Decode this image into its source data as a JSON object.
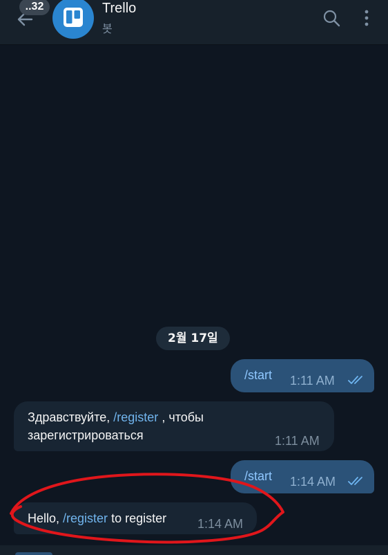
{
  "header": {
    "unread_count": "..32",
    "title": "Trello",
    "subtitle": "봇",
    "avatar_icon": "trello-logo-icon",
    "colors": {
      "header_bg": "#17212b",
      "avatar_bg": "#2a85d0",
      "subtitle": "#7f91a4"
    }
  },
  "date_separator": "2월 17일",
  "messages": [
    {
      "direction": "outgoing",
      "parts": [
        {
          "type": "command",
          "text": "/start"
        }
      ],
      "time": "1:11 AM",
      "status": "read-double-check"
    },
    {
      "direction": "incoming",
      "parts": [
        {
          "type": "text",
          "text": "Здравствуйте, "
        },
        {
          "type": "command",
          "text": "/register"
        },
        {
          "type": "text",
          "text": " , чтобы зарегистрироваться"
        }
      ],
      "time": "1:11 AM"
    },
    {
      "direction": "outgoing",
      "parts": [
        {
          "type": "command",
          "text": "/start"
        }
      ],
      "time": "1:14 AM",
      "status": "read-double-check"
    },
    {
      "direction": "incoming",
      "parts": [
        {
          "type": "text",
          "text": "Hello, "
        },
        {
          "type": "command",
          "text": "/register"
        },
        {
          "type": "text",
          "text": " to register"
        }
      ],
      "time": "1:14 AM"
    }
  ],
  "colors": {
    "chat_bg": "#0e1621",
    "outgoing_bubble": "#2b5278",
    "incoming_bubble": "#182533",
    "command_link": "#71b5ee",
    "annotation_circle": "#e0161b"
  }
}
